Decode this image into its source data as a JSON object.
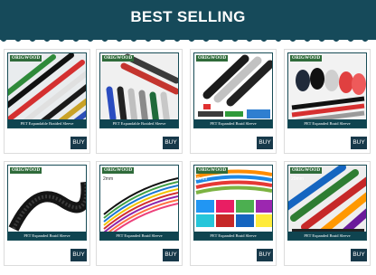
{
  "header": {
    "title": "BEST SELLING",
    "background_color": "#164a5a"
  },
  "products": [
    {
      "brand": "ORIGWOOD",
      "size_tag": "",
      "caption": "PET Expandable Braided Sleeve",
      "buy_label": "BUY"
    },
    {
      "brand": "ORIGWOOD",
      "size_tag": "",
      "caption": "PET Expandable Braided Sleeve",
      "buy_label": "BUY"
    },
    {
      "brand": "ORIGWOOD",
      "size_tag": "14mm",
      "caption": "PET Expanded Braid Sleeve",
      "buy_label": "BUY"
    },
    {
      "brand": "ORIGWOOD",
      "size_tag": "",
      "caption": "PET Expanded Braid Sleeve",
      "buy_label": "BUY"
    },
    {
      "brand": "ORIGWOOD",
      "size_tag": "Black",
      "caption": "PET Expanded Braid Sleeve",
      "buy_label": "BUY"
    },
    {
      "brand": "ORIGWOOD",
      "size_tag": "2mm",
      "caption": "PET Expanded Braid Sleeve",
      "buy_label": "BUY"
    },
    {
      "brand": "ORIGWOOD",
      "size_tag": "8mm",
      "caption": "PET Expanded Braid Sleeve",
      "buy_label": "BUY"
    },
    {
      "brand": "ORIGWOOD",
      "size_tag": "20mm",
      "caption": "PET Expanded Braid Sleeve",
      "buy_label": "BUY"
    }
  ],
  "colors": {
    "caption_bar": "#0f4450",
    "buy_button": "#17394a",
    "brand_badge": "#2f6b3a"
  }
}
